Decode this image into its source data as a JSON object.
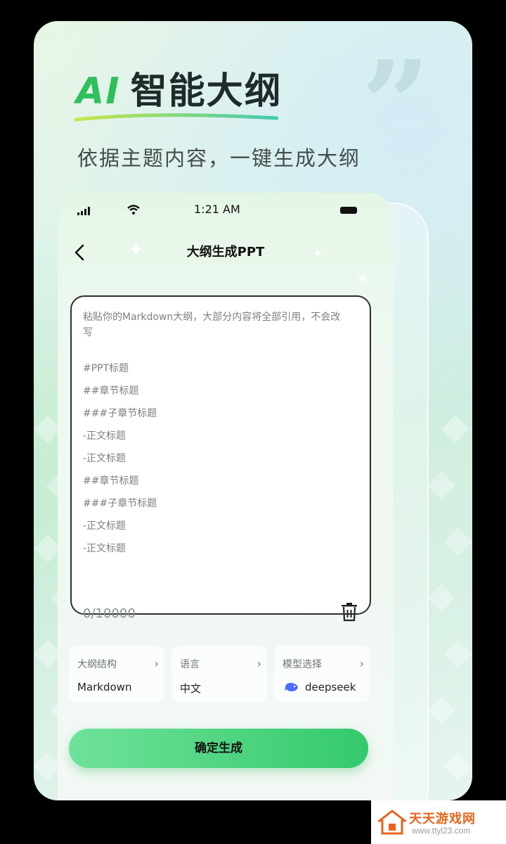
{
  "hero": {
    "ai_label": "AI",
    "title_rest": "智能大纲",
    "subtitle": "依据主题内容，一键生成大纲"
  },
  "status_bar": {
    "time": "1:21 AM"
  },
  "nav": {
    "title": "大纲生成PPT",
    "back_icon": "chevron-left-icon"
  },
  "editor": {
    "placeholder": "粘贴你的Markdown大纲，大部分内容将全部引用，不会改写",
    "lines": [
      "#PPT标题",
      "##章节标题",
      "###子章节标题",
      "-正文标题",
      "-正文标题",
      "##章节标题",
      "###子章节标题",
      "-正文标题",
      "-正文标题"
    ],
    "counter": "0/10000",
    "clear_icon": "trash-icon"
  },
  "options": [
    {
      "label": "大纲结构",
      "value": "Markdown"
    },
    {
      "label": "语言",
      "value": "中文"
    },
    {
      "label": "模型选择",
      "value": "deepseek",
      "icon": "deepseek-whale-icon"
    }
  ],
  "confirm_label": "确定生成",
  "watermark": {
    "name": "天天游戏网",
    "url": "www.ttyl23.com"
  },
  "colors": {
    "accent_green": "#34c96c",
    "ai_green": "#2fbf5b",
    "watermark_orange": "#e8641c",
    "deepseek_blue": "#4d6bfe"
  }
}
